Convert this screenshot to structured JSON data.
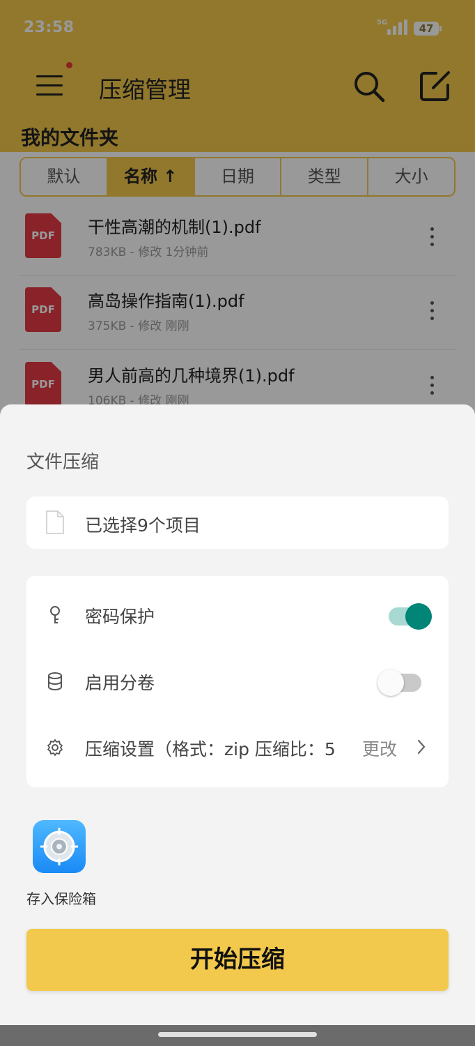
{
  "status_bar": {
    "time": "23:58",
    "network": "5G",
    "battery": "47"
  },
  "header": {
    "title": "压缩管理",
    "folder_title": "我的文件夹"
  },
  "sort_tabs": [
    {
      "label": "默认"
    },
    {
      "label": "名称 ↑"
    },
    {
      "label": "日期"
    },
    {
      "label": "类型"
    },
    {
      "label": "大小"
    }
  ],
  "active_sort_index": 1,
  "files": [
    {
      "icon_text": "PDF",
      "name": "干性高潮的机制(1).pdf",
      "meta": "783KB - 修改 1分钟前"
    },
    {
      "icon_text": "PDF",
      "name": "高岛操作指南(1).pdf",
      "meta": "375KB - 修改 刚刚"
    },
    {
      "icon_text": "PDF",
      "name": "男人前高的几种境界(1).pdf",
      "meta": "106KB - 修改 刚刚"
    }
  ],
  "sheet": {
    "title": "文件压缩",
    "selection_text": "已选择9个项目",
    "password_label": "密码保护",
    "password_on": true,
    "split_label": "启用分卷",
    "split_on": false,
    "settings_label": "压缩设置（格式：zip  压缩比：5",
    "settings_action": "更改",
    "vault_label": "存入保险箱",
    "start_button": "开始压缩"
  },
  "colors": {
    "accent": "#f2c94c",
    "toggle_on": "#008577",
    "pdf_red": "#e53945"
  },
  "icons": [
    "menu-icon",
    "search-icon",
    "edit-icon",
    "pdf-file-icon",
    "more-vert-icon",
    "document-icon",
    "key-icon",
    "database-icon",
    "gear-icon",
    "chevron-right-icon",
    "vault-icon"
  ]
}
